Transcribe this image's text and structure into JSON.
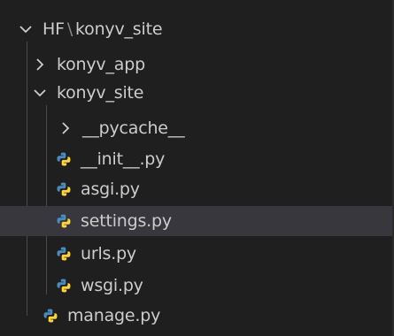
{
  "explorer": {
    "root": {
      "parent": "HF",
      "separator": "\\",
      "name": "konyv_site",
      "state": "expanded"
    },
    "items": [
      {
        "label": "konyv_app",
        "type": "folder",
        "state": "collapsed"
      },
      {
        "label": "konyv_site",
        "type": "folder",
        "state": "expanded"
      },
      {
        "label": "__pycache__",
        "type": "folder",
        "state": "collapsed"
      },
      {
        "label": "__init__.py",
        "type": "file",
        "icon": "python-icon"
      },
      {
        "label": "asgi.py",
        "type": "file",
        "icon": "python-icon"
      },
      {
        "label": "settings.py",
        "type": "file",
        "icon": "python-icon",
        "selected": true
      },
      {
        "label": "urls.py",
        "type": "file",
        "icon": "python-icon"
      },
      {
        "label": "wsgi.py",
        "type": "file",
        "icon": "python-icon"
      },
      {
        "label": "manage.py",
        "type": "file",
        "icon": "python-icon"
      }
    ]
  },
  "colors": {
    "background": "#1f1f1f",
    "text": "#cccccc",
    "selected_row": "#37373d",
    "python_blue": "#4b8bbe",
    "python_yellow": "#ffd43b",
    "indent_guide": "#4a4a4a"
  }
}
